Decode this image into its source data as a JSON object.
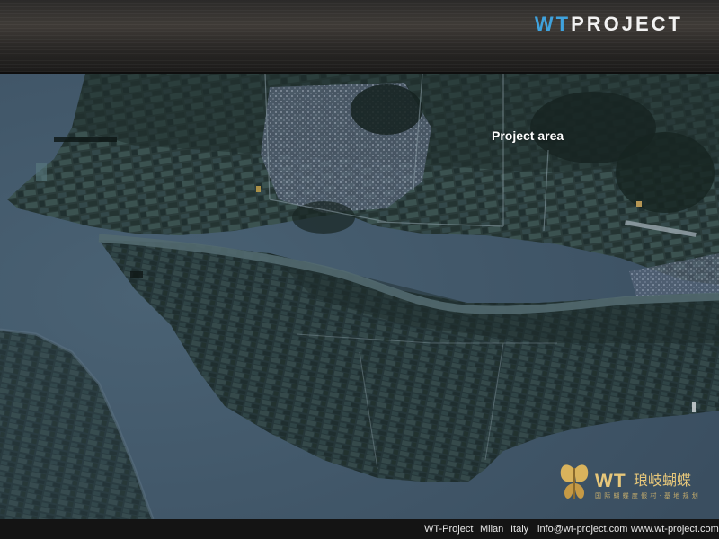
{
  "header": {
    "logo_wt": "WT",
    "logo_project": "PROJECT"
  },
  "map": {
    "label": "Project area",
    "colors": {
      "sea": "#415566",
      "sea_light": "#4a6274",
      "land_dark": "#1d2a2b",
      "land_mid": "#2a3b3b",
      "land_light": "#3a4f4d",
      "river": "#52696f",
      "urban": "#8a96a6"
    }
  },
  "brand": {
    "wt": "WT",
    "chinese": "琅岐蝴蝶",
    "chinese_sub": "国 际 蝴 蝶 度 假 村 · 基 地 规 划"
  },
  "footer": {
    "company": "WT-Project",
    "city": "Milan",
    "country": "Italy",
    "email": "info@wt-project.com",
    "website": "www.wt-project.com"
  }
}
